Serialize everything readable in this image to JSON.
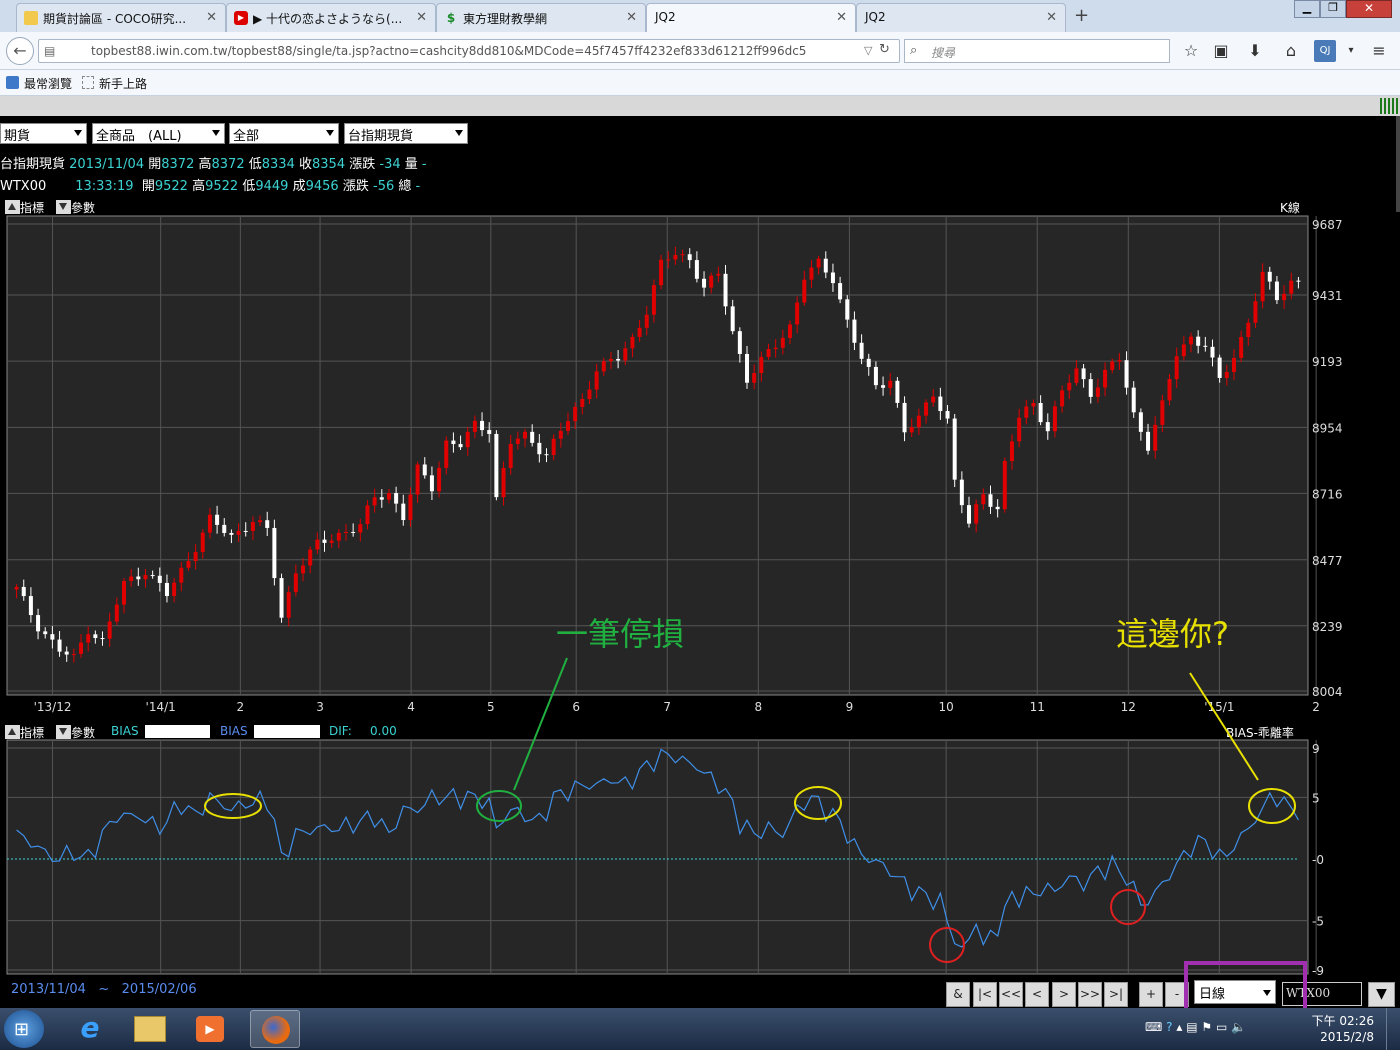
{
  "browser": {
    "tabs": [
      {
        "label": "期貨討論區 - COCO研究...",
        "icon": "folder-icon"
      },
      {
        "label": "▶ 十代の恋よさようなら(...",
        "icon": "youtube-icon"
      },
      {
        "label": "東方理財教學網",
        "icon": "dollar-icon"
      },
      {
        "label": "JQ2",
        "icon": ""
      },
      {
        "label": "JQ2",
        "icon": ""
      }
    ],
    "new_tab": "+",
    "url": "topbest88.iwin.com.tw/topbest88/single/ta.jsp?actno=cashcity8dd810&MDCode=45f7457ff4232ef833d61212ff996dc5",
    "search_placeholder": "搜尋",
    "bookmarks": [
      "最常瀏覽",
      "新手上路"
    ]
  },
  "app": {
    "selects": [
      "期貨",
      "全商品　(ALL)",
      "全部",
      "台指期現貨"
    ],
    "quote1": {
      "name": "台指期現貨",
      "date": "2013/11/04",
      "open_l": "開",
      "open": "8372",
      "high_l": "高",
      "high": "8372",
      "low_l": "低",
      "low": "8334",
      "close_l": "收",
      "close": "8354",
      "chg_l": "漲跌",
      "chg": "-34",
      "vol_l": "量",
      "vol": "-"
    },
    "quote2": {
      "name": "WTX00",
      "time": "13:33:19",
      "open_l": "開",
      "open": "9522",
      "high_l": "高",
      "high": "9522",
      "low_l": "低",
      "low": "9449",
      "close_l": "成",
      "close": "9456",
      "chg_l": "漲跌",
      "chg": "-56",
      "vol_l": "總",
      "vol": "-"
    },
    "top_panel": {
      "indicator": "指標",
      "param": "參數",
      "type_label": "K線"
    },
    "bottom_panel": {
      "indicator": "指標",
      "param": "參數",
      "bias1": "BIAS",
      "bias2": "BIAS",
      "dif_label": "DIF:",
      "dif": "0.00",
      "type_label": "BIAS-乖離率"
    },
    "annotations": {
      "stop_loss": "一筆停損",
      "here_you": "這邊你?"
    },
    "date_range": {
      "from": "2013/11/04",
      "sep": "~",
      "to": "2015/02/06"
    },
    "nav_buttons": [
      "&",
      "|<",
      "<<",
      "<",
      ">",
      ">>",
      ">|",
      "+",
      "-"
    ],
    "period": "日線",
    "symbol": "WTX00",
    "colors": {
      "up": "#e00000",
      "down": "#ffffff",
      "bias": "#3f8fe8",
      "zero": "#3cd2d2",
      "grid": "#555555",
      "yellow": "#e8e000",
      "green": "#20b040",
      "red": "#e02020",
      "purple": "#a030b0"
    }
  },
  "taskbar": {
    "time": "下午 02:26",
    "date": "2015/2/8"
  },
  "chart_data": [
    {
      "type": "candlestick",
      "title": "K線",
      "ylim": [
        8004,
        9687
      ],
      "yticks": [
        9687,
        9431,
        9193,
        8954,
        8716,
        8477,
        8239,
        8004
      ],
      "xticks": [
        "'13/12",
        "'14/1",
        "2",
        "3",
        "4",
        "5",
        "6",
        "7",
        "8",
        "9",
        "10",
        "11",
        "12",
        "'15/1",
        "2"
      ],
      "close_path": [
        [
          0,
          8370
        ],
        [
          3,
          8240
        ],
        [
          6,
          8150
        ],
        [
          8,
          8120
        ],
        [
          10,
          8230
        ],
        [
          12,
          8180
        ],
        [
          15,
          8390
        ],
        [
          18,
          8440
        ],
        [
          21,
          8350
        ],
        [
          24,
          8480
        ],
        [
          27,
          8620
        ],
        [
          30,
          8560
        ],
        [
          33,
          8620
        ],
        [
          35,
          8580
        ],
        [
          36,
          8420
        ],
        [
          37,
          8270
        ],
        [
          39,
          8440
        ],
        [
          42,
          8530
        ],
        [
          45,
          8570
        ],
        [
          48,
          8600
        ],
        [
          50,
          8700
        ],
        [
          52,
          8720
        ],
        [
          54,
          8630
        ],
        [
          56,
          8800
        ],
        [
          58,
          8740
        ],
        [
          60,
          8900
        ],
        [
          62,
          8890
        ],
        [
          64,
          8960
        ],
        [
          66,
          8950
        ],
        [
          67,
          8700
        ],
        [
          69,
          8900
        ],
        [
          71,
          8920
        ],
        [
          74,
          8860
        ],
        [
          77,
          8980
        ],
        [
          79,
          9050
        ],
        [
          81,
          9170
        ],
        [
          84,
          9200
        ],
        [
          86,
          9270
        ],
        [
          88,
          9380
        ],
        [
          90,
          9540
        ],
        [
          92,
          9580
        ],
        [
          94,
          9560
        ],
        [
          96,
          9460
        ],
        [
          98,
          9500
        ],
        [
          100,
          9300
        ],
        [
          102,
          9130
        ],
        [
          104,
          9190
        ],
        [
          106,
          9250
        ],
        [
          108,
          9320
        ],
        [
          110,
          9500
        ],
        [
          112,
          9540
        ],
        [
          114,
          9490
        ],
        [
          116,
          9340
        ],
        [
          118,
          9200
        ],
        [
          120,
          9100
        ],
        [
          122,
          9130
        ],
        [
          124,
          8940
        ],
        [
          126,
          8980
        ],
        [
          128,
          9080
        ],
        [
          130,
          8980
        ],
        [
          131,
          8760
        ],
        [
          133,
          8600
        ],
        [
          135,
          8720
        ],
        [
          137,
          8660
        ],
        [
          138,
          8820
        ],
        [
          140,
          8990
        ],
        [
          142,
          9040
        ],
        [
          144,
          8950
        ],
        [
          146,
          9080
        ],
        [
          148,
          9160
        ],
        [
          150,
          9080
        ],
        [
          152,
          9150
        ],
        [
          154,
          9200
        ],
        [
          156,
          9000
        ],
        [
          158,
          8890
        ],
        [
          160,
          9030
        ],
        [
          162,
          9220
        ],
        [
          164,
          9280
        ],
        [
          166,
          9250
        ],
        [
          168,
          9120
        ],
        [
          170,
          9210
        ],
        [
          172,
          9340
        ],
        [
          174,
          9500
        ],
        [
          176,
          9420
        ],
        [
          178,
          9480
        ]
      ],
      "n": 180
    },
    {
      "type": "line",
      "title": "BIAS-乖離率",
      "ylim": [
        -9,
        9
      ],
      "yticks": [
        9,
        5,
        0,
        -5,
        -9
      ],
      "series": [
        {
          "name": "BIAS",
          "points": [
            [
              0,
              2
            ],
            [
              3,
              1
            ],
            [
              5,
              0
            ],
            [
              8,
              0.5
            ],
            [
              10,
              0
            ],
            [
              12,
              2
            ],
            [
              14,
              3.5
            ],
            [
              17,
              3.5
            ],
            [
              20,
              2.5
            ],
            [
              23,
              4.5
            ],
            [
              25,
              3.5
            ],
            [
              27,
              5
            ],
            [
              30,
              4
            ],
            [
              32,
              4.5
            ],
            [
              35,
              4.8
            ],
            [
              36,
              3
            ],
            [
              37,
              0
            ],
            [
              39,
              2
            ],
            [
              42,
              2.5
            ],
            [
              45,
              2.5
            ],
            [
              48,
              3
            ],
            [
              50,
              3.5
            ],
            [
              52,
              2
            ],
            [
              54,
              4
            ],
            [
              56,
              4
            ],
            [
              58,
              5
            ],
            [
              60,
              5
            ],
            [
              62,
              5
            ],
            [
              64,
              5
            ],
            [
              66,
              4.5
            ],
            [
              67,
              2.5
            ],
            [
              69,
              4
            ],
            [
              71,
              3.5
            ],
            [
              73,
              3
            ],
            [
              75,
              5
            ],
            [
              77,
              5.5
            ],
            [
              79,
              6
            ],
            [
              81,
              6
            ],
            [
              83,
              6.5
            ],
            [
              85,
              6
            ],
            [
              87,
              7
            ],
            [
              89,
              8
            ],
            [
              91,
              8.5
            ],
            [
              93,
              8
            ],
            [
              95,
              7.5
            ],
            [
              97,
              6.5
            ],
            [
              99,
              5.5
            ],
            [
              101,
              3
            ],
            [
              103,
              2
            ],
            [
              105,
              2.5
            ],
            [
              107,
              2
            ],
            [
              109,
              4
            ],
            [
              111,
              5
            ],
            [
              113,
              4
            ],
            [
              115,
              3
            ],
            [
              117,
              1
            ],
            [
              119,
              0
            ],
            [
              121,
              -0.5
            ],
            [
              123,
              -1.5
            ],
            [
              125,
              -2.5
            ],
            [
              127,
              -3
            ],
            [
              129,
              -3.5
            ],
            [
              130,
              -5
            ],
            [
              131,
              -6.5
            ],
            [
              132,
              -7.5
            ],
            [
              133,
              -6.5
            ],
            [
              134,
              -5
            ],
            [
              135,
              -7
            ],
            [
              137,
              -5.5
            ],
            [
              139,
              -3
            ],
            [
              141,
              -3
            ],
            [
              143,
              -2.5
            ],
            [
              145,
              -2.5
            ],
            [
              147,
              -1.5
            ],
            [
              149,
              -2
            ],
            [
              151,
              -1
            ],
            [
              153,
              -0.5
            ],
            [
              155,
              -1.5
            ],
            [
              157,
              -3.5
            ],
            [
              158,
              -3.5
            ],
            [
              160,
              -2
            ],
            [
              162,
              -0.5
            ],
            [
              164,
              1
            ],
            [
              166,
              1.5
            ],
            [
              168,
              0
            ],
            [
              170,
              1
            ],
            [
              172,
              2.5
            ],
            [
              174,
              4
            ],
            [
              175,
              5
            ],
            [
              176,
              5
            ],
            [
              178,
              4
            ]
          ]
        }
      ],
      "zero_line": 0,
      "n": 180
    }
  ]
}
